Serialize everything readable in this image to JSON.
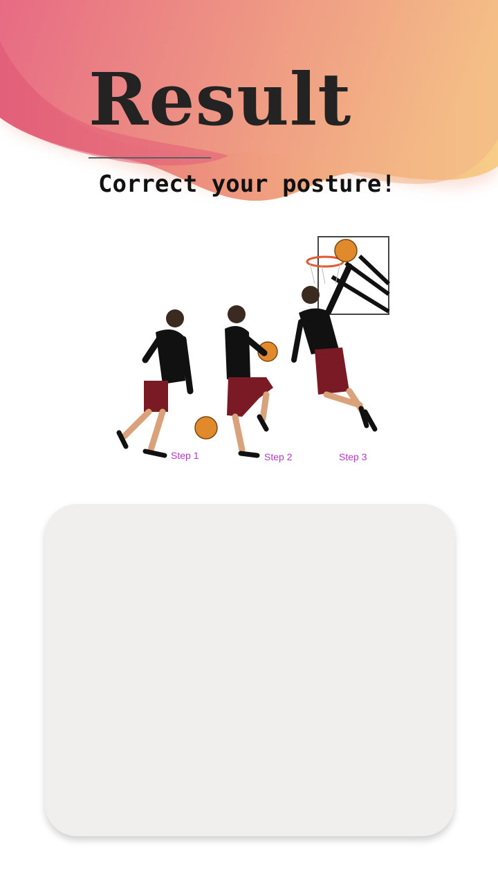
{
  "header": {
    "title": "Result",
    "subtitle": "Correct your posture!"
  },
  "illustration": {
    "icon": "basketball-layup-illustration",
    "steps": [
      "Step 1",
      "Step 2",
      "Step 3"
    ]
  },
  "result_card": {
    "text": ""
  },
  "colors": {
    "gradient_pink": "#e4647d",
    "gradient_peach": "#f3a47f",
    "gradient_yellow": "#f7cd88",
    "card_bg": "#f0efee",
    "step_label": "#b33ac0"
  }
}
